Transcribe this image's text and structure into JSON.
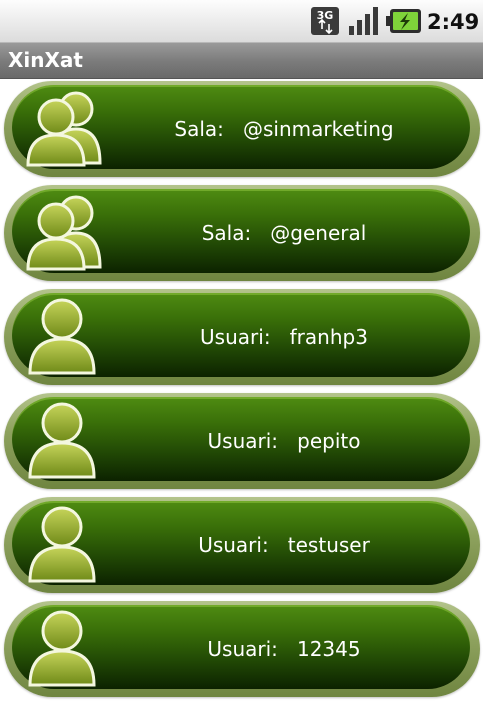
{
  "status_bar": {
    "network_icon": "3g-data-icon",
    "signal_icon": "signal-strength-icon",
    "battery_icon": "battery-charging-icon",
    "time": "2:49"
  },
  "app": {
    "title": "XinXat"
  },
  "list": {
    "items": [
      {
        "kind": "Sala:",
        "name": "@sinmarketing",
        "icon": "group-icon"
      },
      {
        "kind": "Sala:",
        "name": "@general",
        "icon": "group-icon"
      },
      {
        "kind": "Usuari:",
        "name": "franhp3",
        "icon": "user-icon"
      },
      {
        "kind": "Usuari:",
        "name": "pepito",
        "icon": "user-icon"
      },
      {
        "kind": "Usuari:",
        "name": "testuser",
        "icon": "user-icon"
      },
      {
        "kind": "Usuari:",
        "name": "12345",
        "icon": "user-icon"
      }
    ]
  },
  "colors": {
    "pill_top": "#4f8c12",
    "pill_bottom": "#0c2200",
    "pill_border": "#8ea25e",
    "title_bar": "#7a7a7a"
  }
}
